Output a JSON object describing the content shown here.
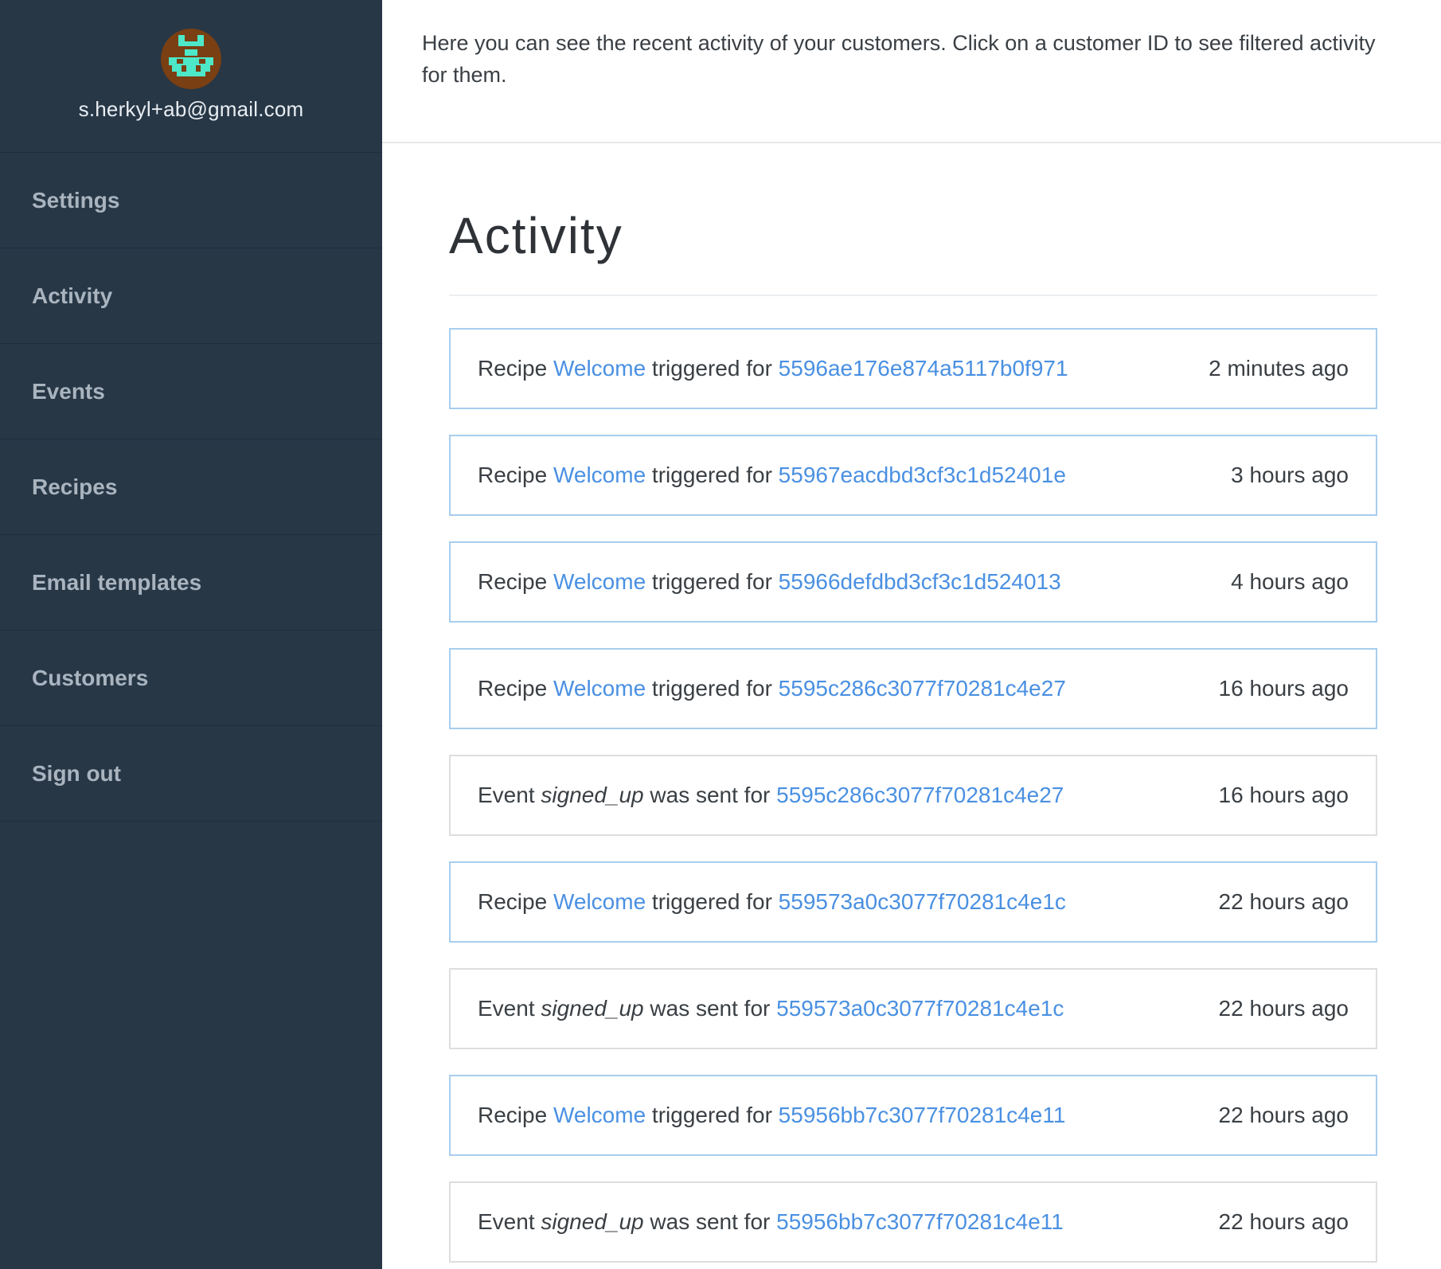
{
  "user": {
    "email": "s.herkyl+ab@gmail.com",
    "avatar_icon": "pixel-robot-avatar"
  },
  "sidebar": {
    "items": [
      {
        "label": "Settings"
      },
      {
        "label": "Activity"
      },
      {
        "label": "Events"
      },
      {
        "label": "Recipes"
      },
      {
        "label": "Email templates"
      },
      {
        "label": "Customers"
      },
      {
        "label": "Sign out"
      }
    ]
  },
  "intro": {
    "text": "Here you can see the recent activity of your customers. Click on a customer ID to see filtered activity for them."
  },
  "page": {
    "title": "Activity"
  },
  "activity": [
    {
      "type": "recipe",
      "prefix": "Recipe",
      "name": "Welcome",
      "middle": "triggered for",
      "customer_id": "5596ae176e874a5117b0f971",
      "time": "2 minutes ago"
    },
    {
      "type": "recipe",
      "prefix": "Recipe",
      "name": "Welcome",
      "middle": "triggered for",
      "customer_id": "55967eacdbd3cf3c1d52401e",
      "time": "3 hours ago"
    },
    {
      "type": "recipe",
      "prefix": "Recipe",
      "name": "Welcome",
      "middle": "triggered for",
      "customer_id": "55966defdbd3cf3c1d524013",
      "time": "4 hours ago"
    },
    {
      "type": "recipe",
      "prefix": "Recipe",
      "name": "Welcome",
      "middle": "triggered for",
      "customer_id": "5595c286c3077f70281c4e27",
      "time": "16 hours ago"
    },
    {
      "type": "event",
      "prefix": "Event",
      "name": "signed_up",
      "middle": "was sent for",
      "customer_id": "5595c286c3077f70281c4e27",
      "time": "16 hours ago"
    },
    {
      "type": "recipe",
      "prefix": "Recipe",
      "name": "Welcome",
      "middle": "triggered for",
      "customer_id": "559573a0c3077f70281c4e1c",
      "time": "22 hours ago"
    },
    {
      "type": "event",
      "prefix": "Event",
      "name": "signed_up",
      "middle": "was sent for",
      "customer_id": "559573a0c3077f70281c4e1c",
      "time": "22 hours ago"
    },
    {
      "type": "recipe",
      "prefix": "Recipe",
      "name": "Welcome",
      "middle": "triggered for",
      "customer_id": "55956bb7c3077f70281c4e11",
      "time": "22 hours ago"
    },
    {
      "type": "event",
      "prefix": "Event",
      "name": "signed_up",
      "middle": "was sent for",
      "customer_id": "55956bb7c3077f70281c4e11",
      "time": "22 hours ago"
    }
  ],
  "colors": {
    "sidebar_bg": "#273746",
    "link": "#4a90e2",
    "recipe_border": "#a8cdef",
    "event_border": "#dcdee0",
    "avatar_bg": "#7a3f12",
    "avatar_fg": "#4de8c8"
  }
}
